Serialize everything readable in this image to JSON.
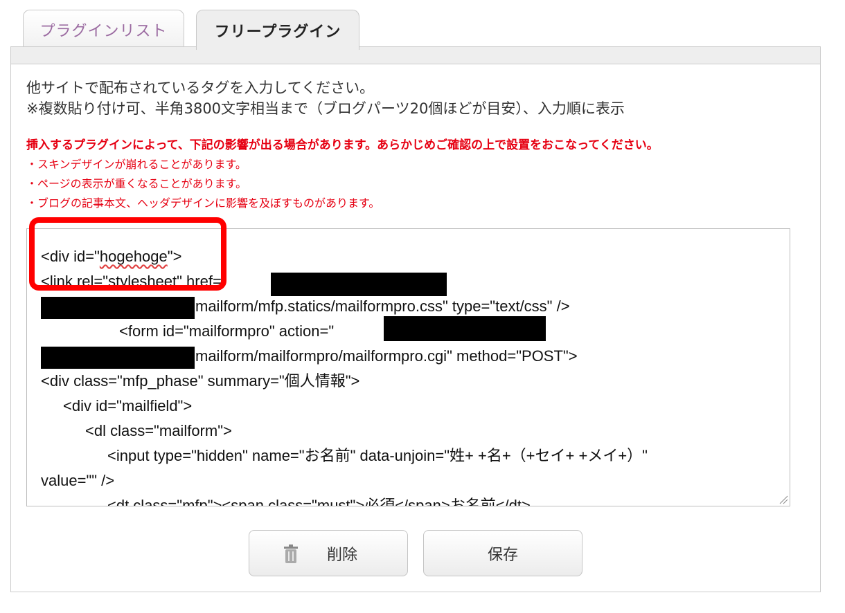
{
  "tabs": [
    {
      "label": "プラグインリスト",
      "active": false
    },
    {
      "label": "フリープラグイン",
      "active": true
    }
  ],
  "instructions": {
    "line1": "他サイトで配布されているタグを入力してください。",
    "line2": "※複数貼り付け可、半角3800文字相当まで（ブログパーツ20個ほどが目安）、入力順に表示"
  },
  "warning": {
    "title": "挿入するプラグインによって、下記の影響が出る場合があります。あらかじめご確認の上で設置をおこなってください。",
    "items": [
      "・スキンデザインが崩れることがあります。",
      "・ページの表示が重くなることがあります。",
      "・ブログの記事本文、ヘッダデザインに影響を及ぼすものがあります。"
    ]
  },
  "code": {
    "line1_prefix": "<div id=\"",
    "line1_word": "hogehoge",
    "line1_suffix": "\">",
    "line2": "<link rel=\"stylesheet\" href=\"",
    "line3": "mailform/mfp.statics/mailformpro.css\" type=\"text/css\" />",
    "line4": "<form id=\"mailformpro\" action=\"",
    "line5": "mailform/mailformpro/mailformpro.cgi\" method=\"POST\">",
    "line6": "<div class=\"mfp_phase\" summary=\"個人情報\">",
    "line7": "<div id=\"mailfield\">",
    "line8": "<dl class=\"mailform\">",
    "line9": "<input type=\"hidden\" name=\"お名前\" data-unjoin=\"姓+ +名+（+セイ+ +メイ+）\"",
    "line10": "value=\"\" />",
    "line11": "<dt class=\"mfp\"><span class=\"must\">必須</span>お名前</dt>"
  },
  "buttons": {
    "delete": "削除",
    "save": "保存"
  },
  "colors": {
    "warning": "#e60012",
    "highlight": "#ff0000",
    "tab_inactive_text": "#9b6ba1"
  },
  "icons": {
    "delete": "trash-icon"
  }
}
